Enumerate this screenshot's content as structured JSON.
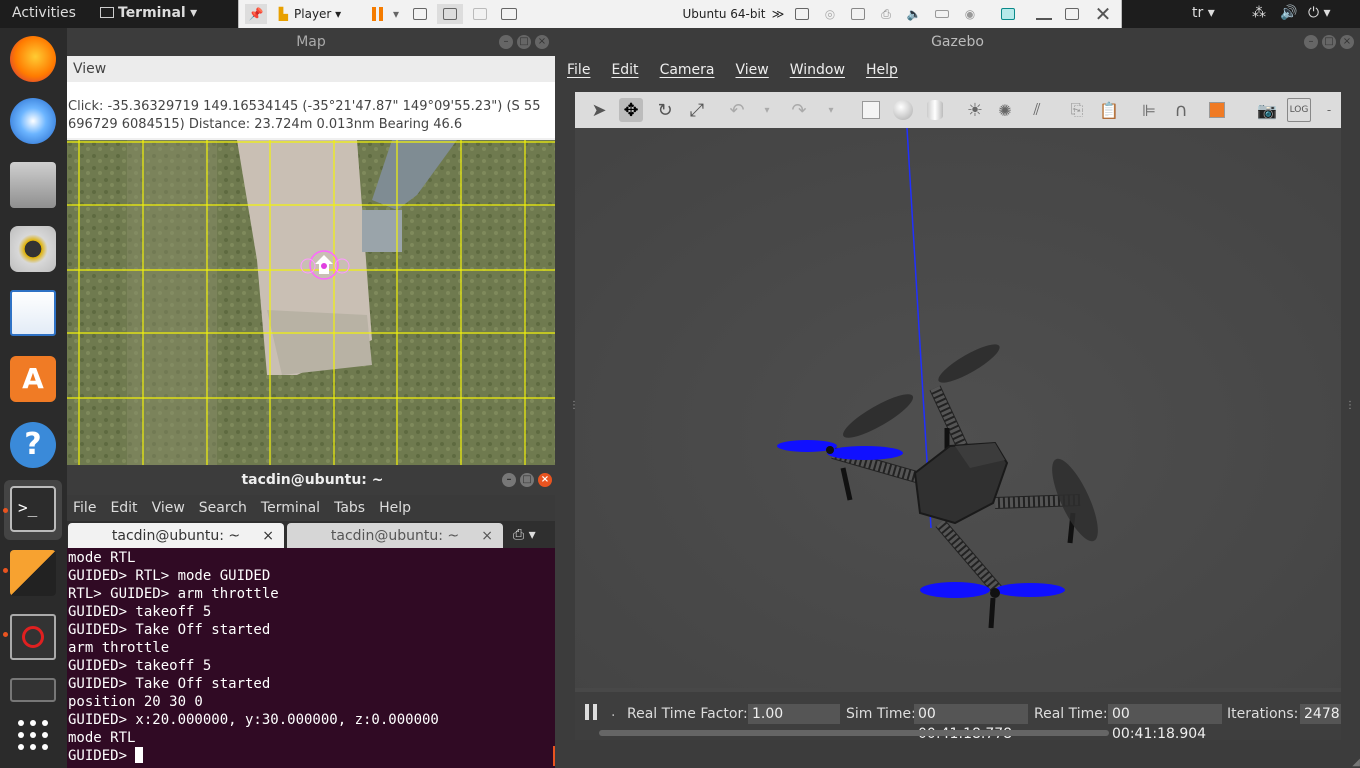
{
  "topbar": {
    "activities": "Activities",
    "app_name": "Terminal",
    "vm_player": "Player",
    "vm_name": "Ubuntu 64-bit",
    "lang": "tr"
  },
  "dock": {
    "items": [
      "firefox-icon",
      "thunderbird-icon",
      "files-icon",
      "rhythmbox-icon",
      "writer-icon",
      "software-icon",
      "help-icon",
      "terminal-icon",
      "qgroundcontrol-icon",
      "blocked-icon",
      "blocked2-icon"
    ]
  },
  "map": {
    "title": "Map",
    "menu": "View",
    "click_line1": "Click: -35.36329719 149.16534145 (-35°21'47.87\" 149°09'55.23\") (S 55",
    "click_line2": "696729 6084515)  Distance: 23.724m 0.013nm Bearing 46.6"
  },
  "terminal": {
    "title": "tacdin@ubuntu: ~",
    "menu": [
      "File",
      "Edit",
      "View",
      "Search",
      "Terminal",
      "Tabs",
      "Help"
    ],
    "tabs": [
      "tacdin@ubuntu: ~",
      "tacdin@ubuntu: ~"
    ],
    "lines": [
      "mode RTL",
      "GUIDED> RTL> mode GUIDED",
      "RTL> GUIDED> arm throttle",
      "GUIDED> takeoff 5",
      "GUIDED> Take Off started",
      "arm throttle",
      "GUIDED> takeoff 5",
      "GUIDED> Take Off started",
      "position 20 30 0",
      "GUIDED> x:20.000000, y:30.000000, z:0.000000",
      "mode RTL",
      "GUIDED> "
    ]
  },
  "gazebo": {
    "title": "Gazebo",
    "menu": [
      "File",
      "Edit",
      "Camera",
      "View",
      "Window",
      "Help"
    ],
    "status": {
      "rtf_label": "Real Time Factor:",
      "rtf_value": "1.00",
      "sim_label": "Sim Time:",
      "sim_value": "00 00:41:18.778",
      "real_label": "Real Time:",
      "real_value": "00 00:41:18.904",
      "iter_label": "Iterations:",
      "iter_value": "2478"
    }
  }
}
